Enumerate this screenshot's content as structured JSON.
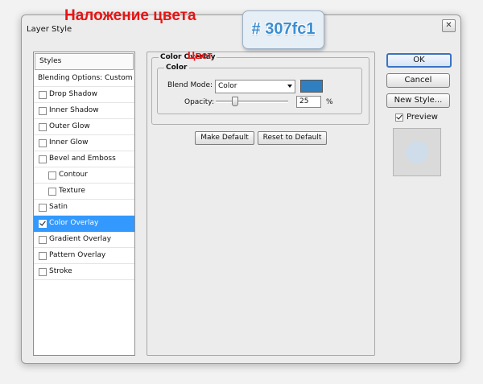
{
  "window": {
    "title": "Layer Style"
  },
  "annotations": {
    "heading_ru": "Наложение цвета",
    "hex": "# 307fc1",
    "color_ru": "Цвет"
  },
  "sidebar": {
    "header": "Styles",
    "items": [
      {
        "label": "Blending Options: Custom",
        "checkbox": false,
        "checked": false,
        "active": false,
        "sub": false
      },
      {
        "label": "Drop Shadow",
        "checkbox": true,
        "checked": false,
        "active": false,
        "sub": false
      },
      {
        "label": "Inner Shadow",
        "checkbox": true,
        "checked": false,
        "active": false,
        "sub": false
      },
      {
        "label": "Outer Glow",
        "checkbox": true,
        "checked": false,
        "active": false,
        "sub": false
      },
      {
        "label": "Inner Glow",
        "checkbox": true,
        "checked": false,
        "active": false,
        "sub": false
      },
      {
        "label": "Bevel and Emboss",
        "checkbox": true,
        "checked": false,
        "active": false,
        "sub": false
      },
      {
        "label": "Contour",
        "checkbox": true,
        "checked": false,
        "active": false,
        "sub": true
      },
      {
        "label": "Texture",
        "checkbox": true,
        "checked": false,
        "active": false,
        "sub": true
      },
      {
        "label": "Satin",
        "checkbox": true,
        "checked": false,
        "active": false,
        "sub": false
      },
      {
        "label": "Color Overlay",
        "checkbox": true,
        "checked": true,
        "active": true,
        "sub": false
      },
      {
        "label": "Gradient Overlay",
        "checkbox": true,
        "checked": false,
        "active": false,
        "sub": false
      },
      {
        "label": "Pattern Overlay",
        "checkbox": true,
        "checked": false,
        "active": false,
        "sub": false
      },
      {
        "label": "Stroke",
        "checkbox": true,
        "checked": false,
        "active": false,
        "sub": false
      }
    ]
  },
  "panel": {
    "group_title": "Color Overlay",
    "subgroup_title": "Color",
    "blend_mode_label": "Blend Mode:",
    "blend_mode_value": "Color",
    "swatch_color": "#307fc1",
    "opacity_label": "Opacity:",
    "opacity_value": "25",
    "opacity_fraction": 0.25,
    "opacity_unit": "%",
    "make_default": "Make Default",
    "reset_default": "Reset to Default"
  },
  "buttons": {
    "ok": "OK",
    "cancel": "Cancel",
    "new_style": "New Style...",
    "preview": "Preview"
  },
  "colors": {
    "accent": "#3399ff",
    "annotation_red": "#e81313",
    "overlay": "#307fc1"
  }
}
